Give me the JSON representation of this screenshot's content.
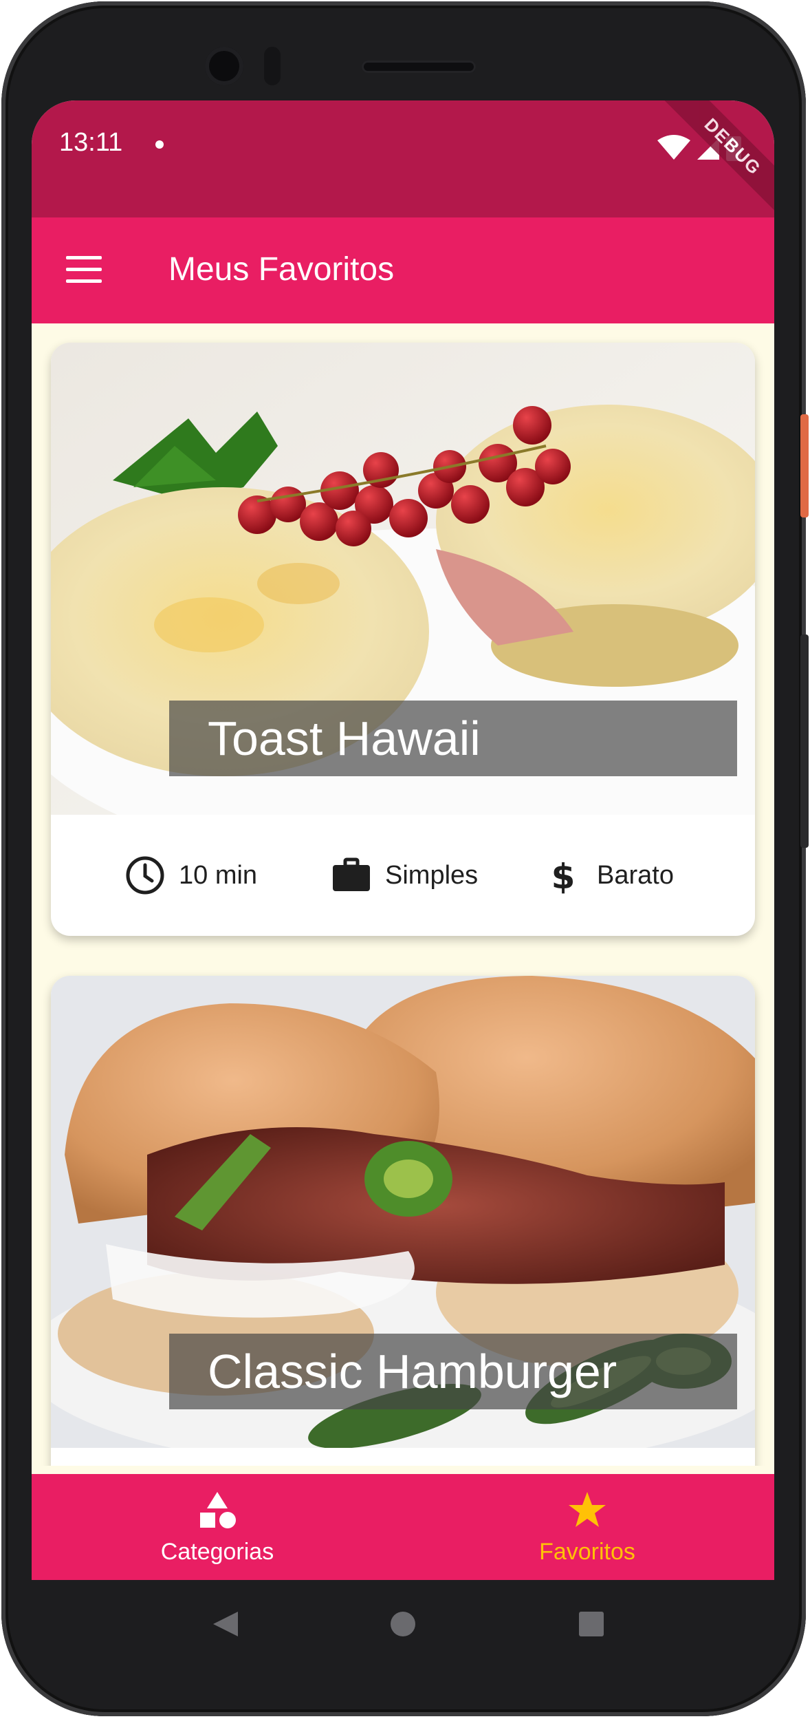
{
  "status_bar": {
    "time": "13:11",
    "debug_label": "DEBUG"
  },
  "app_bar": {
    "title": "Meus Favoritos",
    "menu_icon": "hamburger-menu-icon"
  },
  "meals": [
    {
      "title": "Toast Hawaii",
      "duration": "10 min",
      "complexity": "Simples",
      "cost": "Barato"
    },
    {
      "title": "Classic Hamburger"
    }
  ],
  "bottom_nav": {
    "items": [
      {
        "label": "Categorias",
        "icon": "category-shapes-icon",
        "active": false
      },
      {
        "label": "Favoritos",
        "icon": "star-icon",
        "active": true
      }
    ]
  },
  "colors": {
    "status_bar": "#b3184b",
    "primary": "#e91e63",
    "background": "#fefbe6",
    "active_nav": "#ffc107"
  }
}
